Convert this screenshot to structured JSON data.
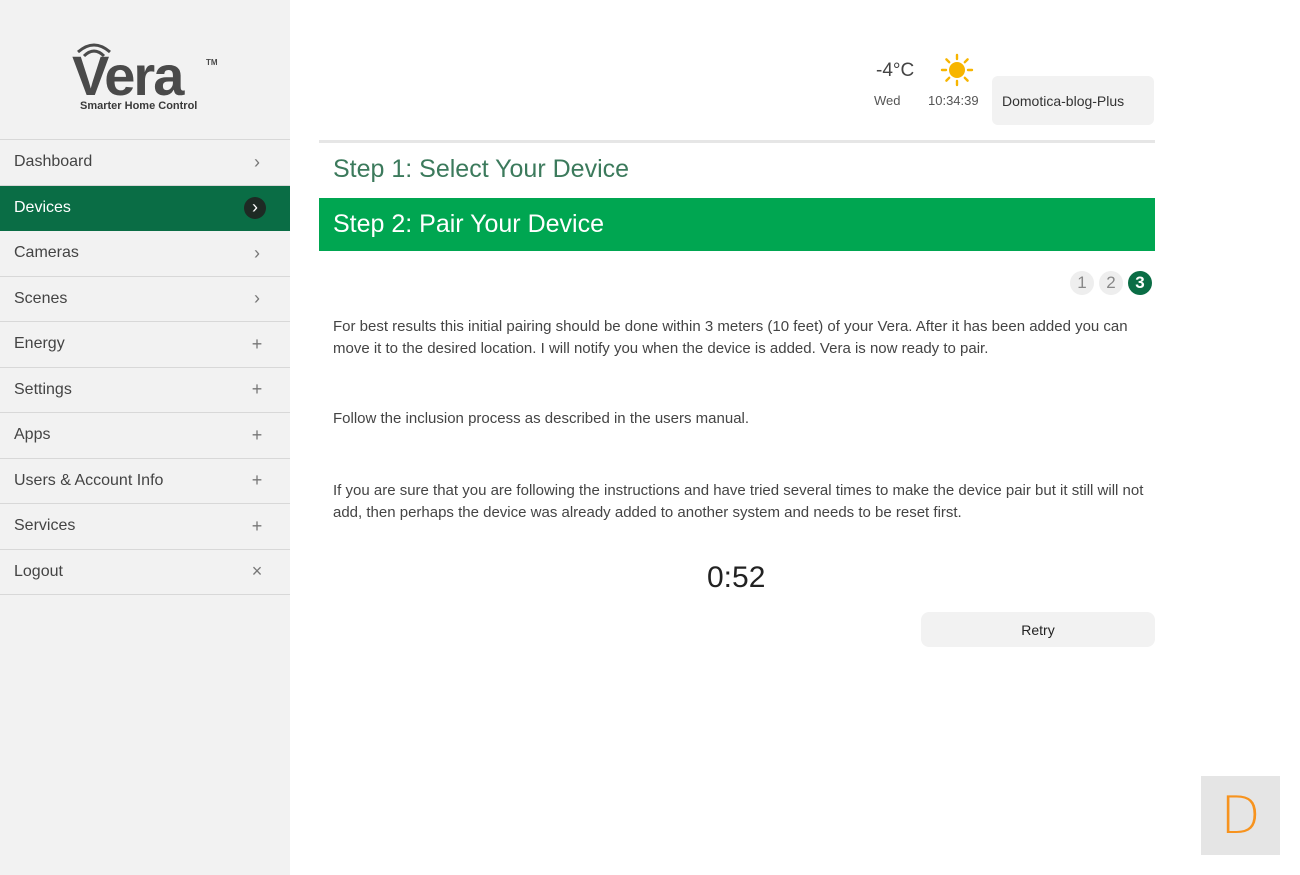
{
  "brand": {
    "name": "Vera",
    "trademark": "TM",
    "tagline": "Smarter Home Control"
  },
  "sidebar": {
    "items": [
      {
        "label": "Dashboard",
        "icon": "chevron-right-icon",
        "glyph": "›"
      },
      {
        "label": "Devices",
        "icon": "chevron-right-icon",
        "glyph": "›",
        "active": true
      },
      {
        "label": "Cameras",
        "icon": "chevron-right-icon",
        "glyph": "›"
      },
      {
        "label": "Scenes",
        "icon": "chevron-right-icon",
        "glyph": "›"
      },
      {
        "label": "Energy",
        "icon": "plus-icon",
        "glyph": "+"
      },
      {
        "label": "Settings",
        "icon": "plus-icon",
        "glyph": "+"
      },
      {
        "label": "Apps",
        "icon": "plus-icon",
        "glyph": "+"
      },
      {
        "label": "Users & Account Info",
        "icon": "plus-icon",
        "glyph": "+"
      },
      {
        "label": "Services",
        "icon": "plus-icon",
        "glyph": "+"
      },
      {
        "label": "Logout",
        "icon": "close-icon",
        "glyph": "×"
      }
    ]
  },
  "header": {
    "temperature": "-4°C",
    "weather_icon": "sun-icon",
    "day": "Wed",
    "time": "10:34:39",
    "account": "Domotica-blog-Plus"
  },
  "wizard": {
    "step1_title": "Step 1: Select Your Device",
    "step2_title": "Step 2: Pair Your Device",
    "pages": [
      "1",
      "2",
      "3"
    ],
    "current_page": "3",
    "paragraphs": [
      "For best results this initial pairing should be done within 3 meters (10 feet) of your Vera. After it has been added you can move it to the desired location. I will notify you when the device is added. Vera is now ready to pair.",
      "Follow the inclusion process as described in the users manual.",
      "If you are sure that you are following the instructions and have tried several times to make the device pair but it still will not add, then perhaps the device was already added to another system and needs to be reset first."
    ],
    "timer": "0:52",
    "retry_label": "Retry"
  },
  "corner_badge": {
    "letter": "D"
  },
  "colors": {
    "active_nav": "#0a6d45",
    "step_bar": "#00a651",
    "step1_text": "#3c7a5c",
    "sun": "#f7b500",
    "badge_letter": "#f7931e"
  }
}
